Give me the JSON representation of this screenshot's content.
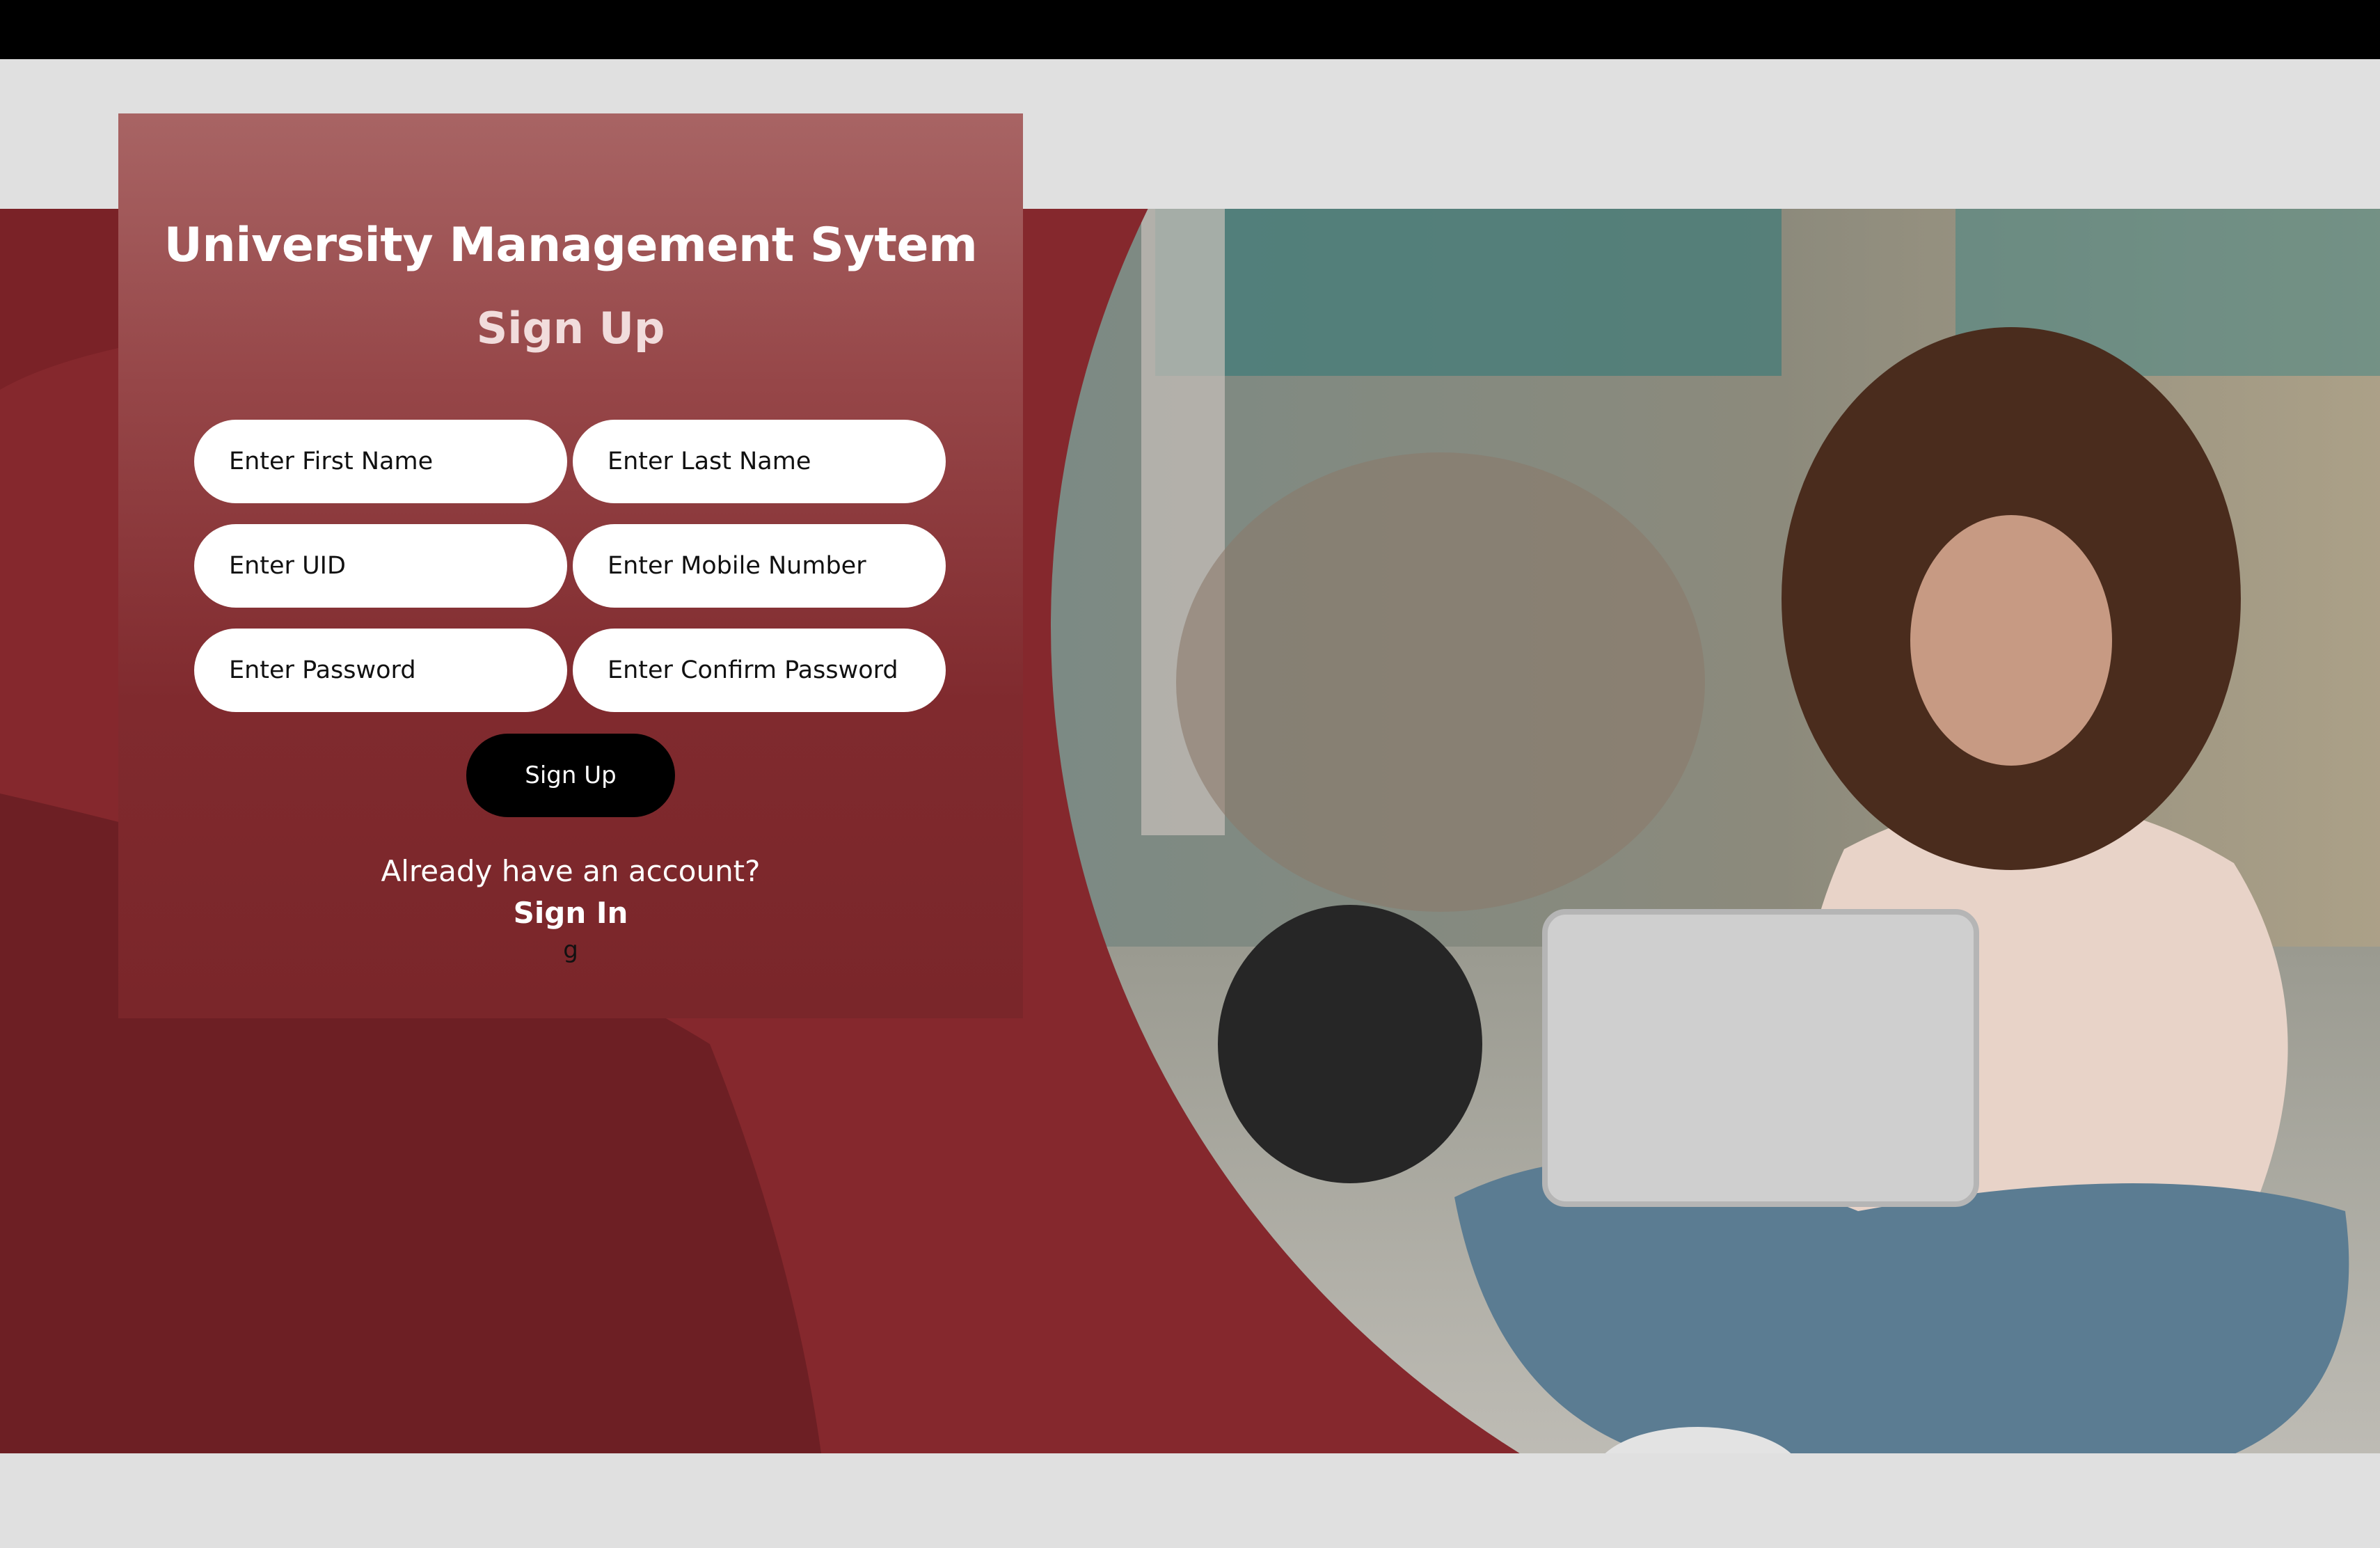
{
  "app": {
    "title": "University Management Sytem",
    "subtitle": "Sign Up"
  },
  "form": {
    "first_name_placeholder": "Enter First Name",
    "last_name_placeholder": "Enter Last Name",
    "uid_placeholder": "Enter UID",
    "mobile_placeholder": "Enter Mobile Number",
    "password_placeholder": "Enter Password",
    "confirm_password_placeholder": "Enter Confirm Password",
    "submit_label": "Sign Up"
  },
  "footer": {
    "prompt": "Already have an account?",
    "signin_label": "Sign In",
    "stray_text": "g"
  },
  "colors": {
    "brand_red": "#85282d",
    "card_top": "#a86464",
    "button": "#000000",
    "input_bg": "#ffffff"
  }
}
